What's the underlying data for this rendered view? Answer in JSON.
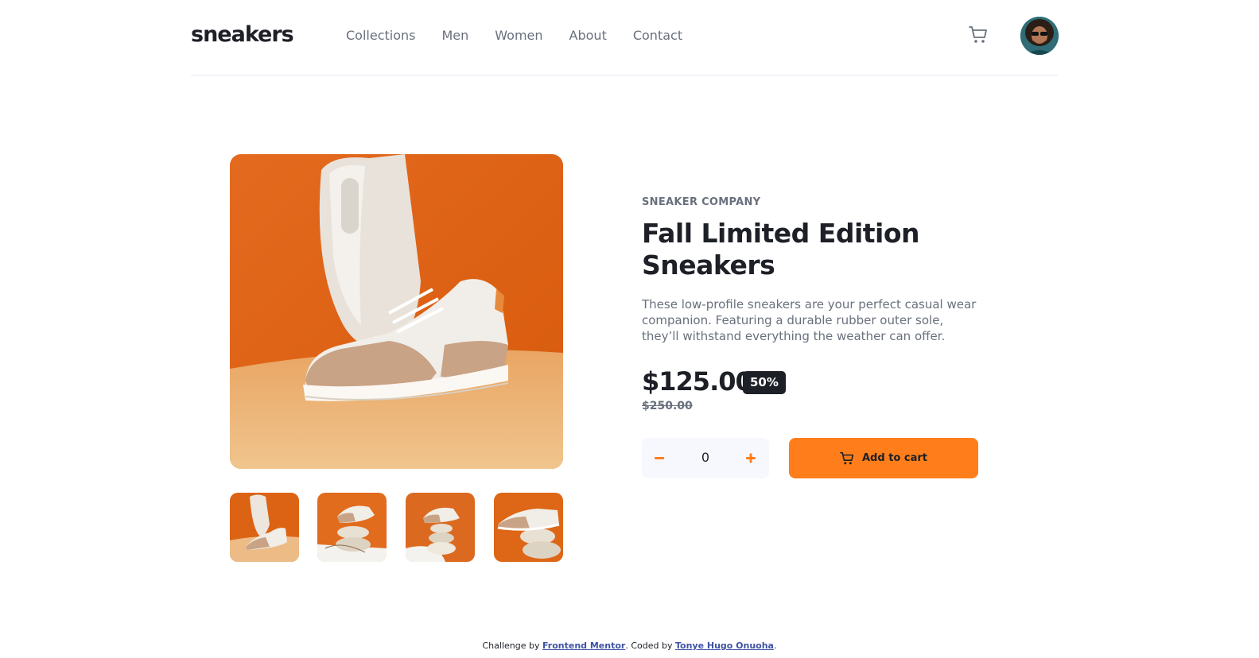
{
  "header": {
    "logo": "sneakers",
    "nav": [
      "Collections",
      "Men",
      "Women",
      "About",
      "Contact"
    ]
  },
  "product": {
    "brand": "SNEAKER COMPANY",
    "title": "Fall Limited Edition Sneakers",
    "description": "These low-profile sneakers are your perfect casual wear companion. Featuring a durable rubber outer sole, they’ll withstand everything the weather can offer.",
    "price": "$125.00",
    "discount": "50%",
    "old_price": "$250.00",
    "quantity": "0",
    "add_to_cart": "Add to cart"
  },
  "footer": {
    "challenge_prefix": "Challenge by",
    "challenge_link": "Frontend Mentor",
    "coded_prefix": ". Coded by",
    "coded_link": "Tonye Hugo Onuoha",
    "suffix": "."
  },
  "colors": {
    "accent": "#ff7e1b",
    "dark": "#1d2026",
    "muted": "#69707d",
    "light_bg": "#f6f8fd"
  },
  "icons": {
    "cart": "cart-icon",
    "minus": "minus-icon",
    "plus": "plus-icon"
  }
}
